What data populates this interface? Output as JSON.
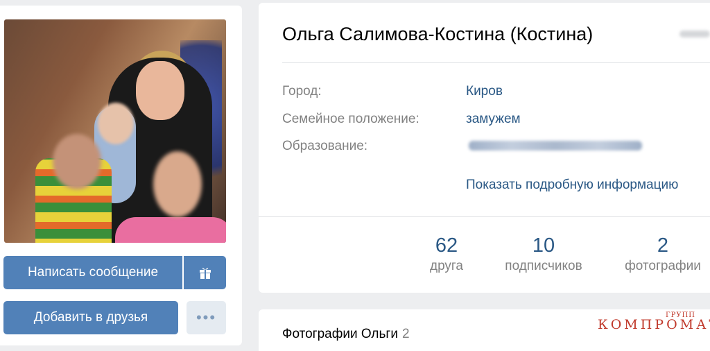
{
  "profile": {
    "name": "Ольга Салимова-Костина (Костина)",
    "info": [
      {
        "label": "Город:",
        "value": "Киров"
      },
      {
        "label": "Семейное положение:",
        "value": "замужем"
      },
      {
        "label": "Образование:",
        "value": ""
      }
    ],
    "more_link": "Показать подробную информацию"
  },
  "actions": {
    "message": "Написать сообщение",
    "add_friend": "Добавить в друзья",
    "more": "•••"
  },
  "counters": [
    {
      "num": "62",
      "label": "друга"
    },
    {
      "num": "10",
      "label": "подписчиков"
    },
    {
      "num": "2",
      "label": "фотографии"
    }
  ],
  "photos": {
    "title": "Фотографии Ольги",
    "count": "2"
  },
  "watermark": {
    "small": "ГРУПП",
    "main": "КОМПРОМАТ"
  },
  "colors": {
    "accent": "#5181b8",
    "link": "#2a5885",
    "muted": "#828282",
    "background": "#edeef0"
  }
}
